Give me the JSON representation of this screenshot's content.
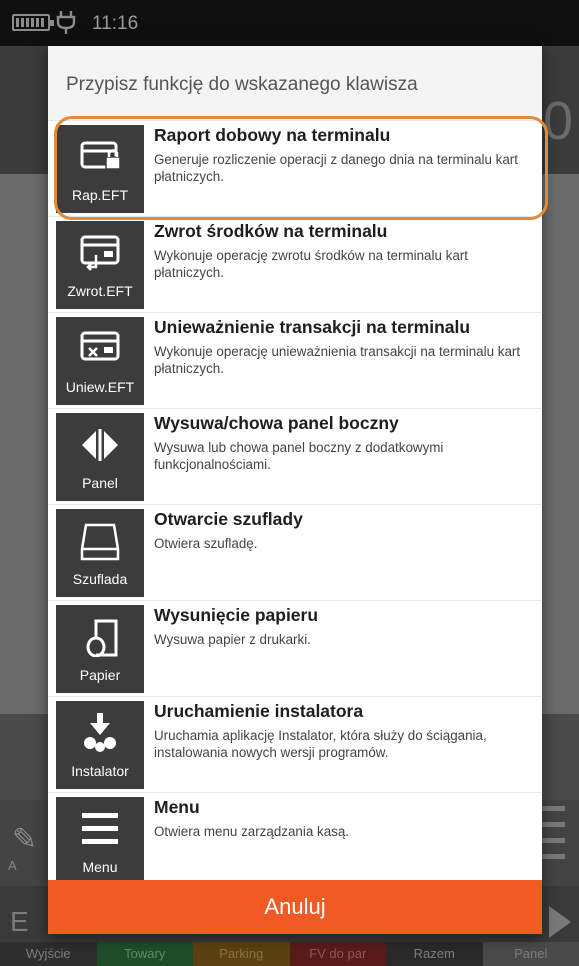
{
  "status_bar": {
    "time": "11:16"
  },
  "background": {
    "big_value": "0",
    "fn_label_left": "A",
    "bottom_letter": "E",
    "bottom_tabs": [
      "Wyjście",
      "Towary",
      "Parking",
      "FV do par",
      "Razem",
      "Panel"
    ]
  },
  "dialog": {
    "title": "Przypisz funkcję do wskazanego klawisza",
    "items": [
      {
        "icon": "card-lock-icon",
        "label": "Rap.EFT",
        "title": "Raport dobowy na terminalu",
        "description": "Generuje rozliczenie operacji z danego dnia na terminalu kart płatniczych."
      },
      {
        "icon": "card-return-icon",
        "label": "Zwrot.EFT",
        "title": "Zwrot środków na terminalu",
        "description": "Wykonuje operację zwrotu środków na terminalu kart płatniczych."
      },
      {
        "icon": "card-cancel-icon",
        "label": "Uniew.EFT",
        "title": "Unieważnienie transakcji na terminalu",
        "description": "Wykonuje operację unieważnienia transakcji na terminalu kart płatniczych."
      },
      {
        "icon": "panel-toggle-icon",
        "label": "Panel",
        "title": "Wysuwa/chowa panel boczny",
        "description": "Wysuwa lub chowa panel boczny z dodatkowymi funkcjonalnościami."
      },
      {
        "icon": "drawer-icon",
        "label": "Szuflada",
        "title": "Otwarcie szuflady",
        "description": "Otwiera szufladę."
      },
      {
        "icon": "paper-roll-icon",
        "label": "Papier",
        "title": "Wysunięcie papieru",
        "description": "Wysuwa papier z drukarki."
      },
      {
        "icon": "installer-icon",
        "label": "Instalator",
        "title": "Uruchamienie instalatora",
        "description": "Uruchamia aplikację Instalator, która służy do ściągania, instalowania nowych wersji programów."
      },
      {
        "icon": "menu-icon",
        "label": "Menu",
        "title": "Menu",
        "description": "Otwiera menu zarządzania kasą."
      }
    ],
    "cancel_label": "Anuluj"
  },
  "colors": {
    "accent": "#f15a24",
    "highlight": "#e08a3c",
    "tile": "#3c3c3c"
  }
}
